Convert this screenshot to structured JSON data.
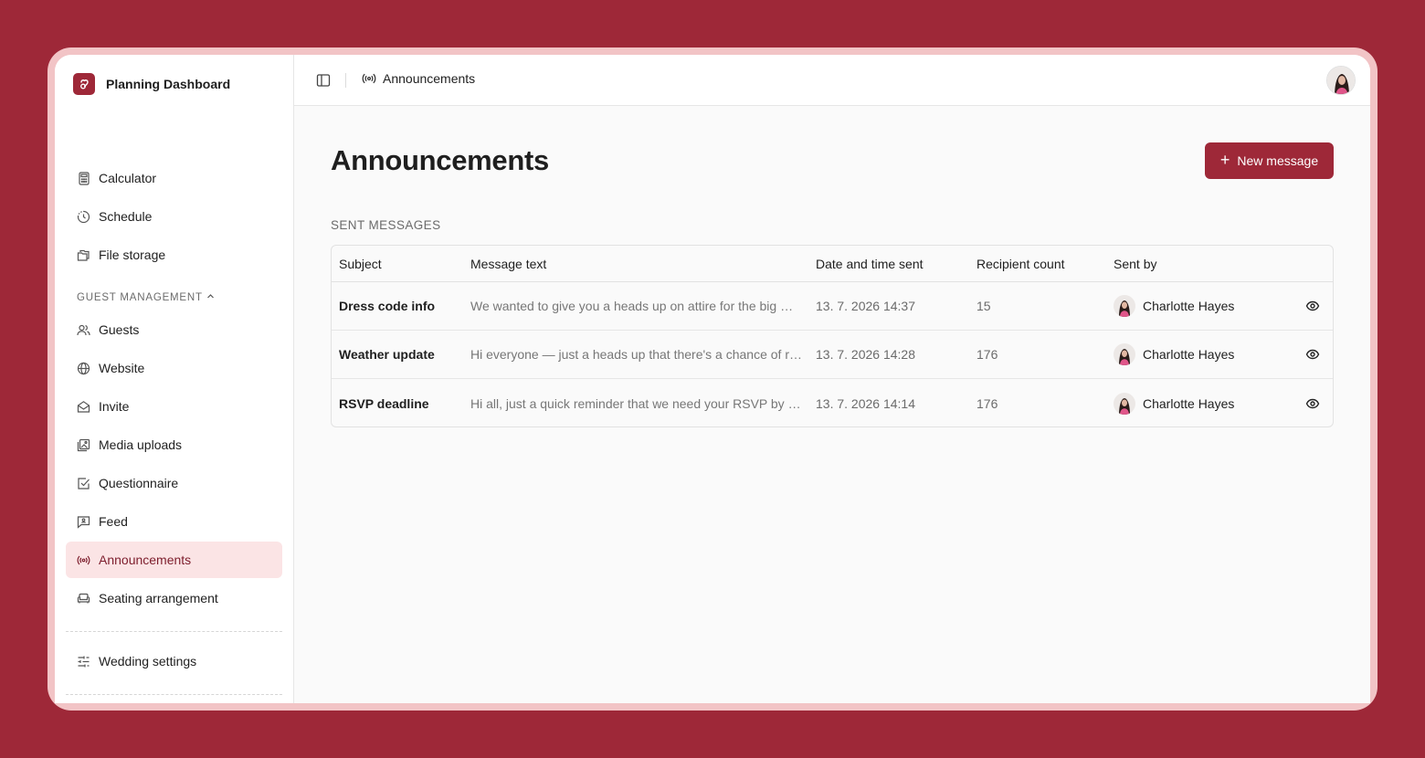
{
  "app": {
    "name": "Planning Dashboard"
  },
  "colors": {
    "brand": "#9e2838",
    "active_bg": "#fbe4e5",
    "active_text": "#7d1d2c"
  },
  "sidebar": {
    "top_items": [
      {
        "label": "Calculator",
        "icon": "calculator-icon"
      },
      {
        "label": "Schedule",
        "icon": "clock-icon"
      },
      {
        "label": "File storage",
        "icon": "files-icon"
      }
    ],
    "section": {
      "label": "GUEST MANAGEMENT",
      "icon": "chevron-up-icon"
    },
    "section_items": [
      {
        "label": "Guests",
        "icon": "users-icon"
      },
      {
        "label": "Website",
        "icon": "globe-icon"
      },
      {
        "label": "Invite",
        "icon": "envelope-open-icon"
      },
      {
        "label": "Media uploads",
        "icon": "images-icon"
      },
      {
        "label": "Questionnaire",
        "icon": "check-square-icon"
      },
      {
        "label": "Feed",
        "icon": "message-square-icon"
      },
      {
        "label": "Announcements",
        "icon": "broadcast-icon",
        "active": true
      },
      {
        "label": "Seating arrangement",
        "icon": "sofa-icon"
      }
    ],
    "bottom_items": [
      {
        "label": "Wedding settings",
        "icon": "sliders-icon"
      }
    ]
  },
  "topbar": {
    "breadcrumb": "Announcements"
  },
  "page": {
    "title": "Announcements",
    "new_button_label": "New message",
    "section_heading": "SENT MESSAGES"
  },
  "table": {
    "columns": [
      "Subject",
      "Message text",
      "Date and time sent",
      "Recipient count",
      "Sent by"
    ],
    "rows": [
      {
        "subject": "Dress code info",
        "message": "We wanted to give you a heads up on attire for the big …",
        "date": "13. 7. 2026 14:37",
        "count": "15",
        "sender": "Charlotte Hayes"
      },
      {
        "subject": "Weather update",
        "message": "Hi everyone — just a heads up that there's a chance of r…",
        "date": "13. 7. 2026 14:28",
        "count": "176",
        "sender": "Charlotte Hayes"
      },
      {
        "subject": "RSVP deadline",
        "message": "Hi all, just a quick reminder that we need your RSVP by …",
        "date": "13. 7. 2026 14:14",
        "count": "176",
        "sender": "Charlotte Hayes"
      }
    ]
  }
}
